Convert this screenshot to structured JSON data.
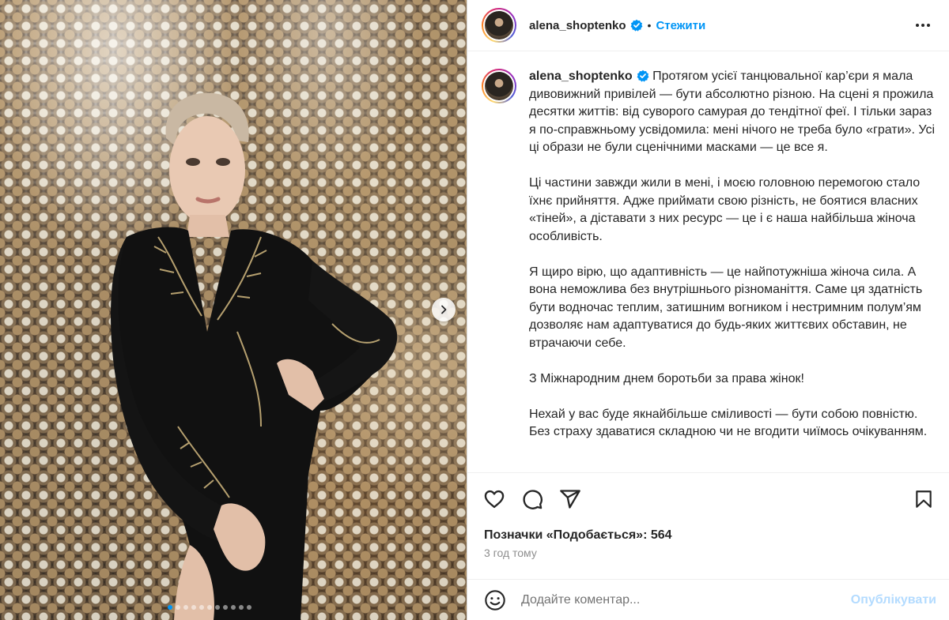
{
  "post": {
    "username": "alena_shoptenko",
    "verified": true,
    "follow_label": "Стежити",
    "separator": "•"
  },
  "caption": {
    "username": "alena_shoptenko",
    "paragraphs": [
      "Протягом усієї танцювальної кар’єри я мала дивовижний привілей — бути абсолютно різною. На сцені я прожила десятки життів: від суворого самурая до тендітної феї. І тільки зараз я по-справжньому усвідомила: мені нічого не треба було «грати». Усі ці образи не були сценічними масками — це все я.",
      "Ці частини завжди жили в мені, і моєю головною перемогою стало їхнє прийняття. Адже приймати свою різність, не боятися власних «тіней», а діставати з них ресурс — це і є наша найбільша жіноча особливість.",
      "Я щиро вірю, що адаптивність — це найпотужніша жіноча сила. А вона неможлива без внутрішнього різноманіття. Саме ця здатність бути водночас теплим, затишним вогником і нестримним полум’ям дозволяє нам адаптуватися до будь-яких життєвих обставин, не втрачаючи себе.",
      "З Міжнародним днем боротьби за права жінок!",
      "Нехай у вас буде якнайбільше сміливості — бути собою повністю. Без страху здаватися складною чи не вгодити чиїмось очікуванням."
    ]
  },
  "engagement": {
    "likes_label": "Позначки «Подобається»: 564",
    "time_ago": "3 год тому"
  },
  "comment": {
    "placeholder": "Додайте коментар...",
    "publish_label": "Опублікувати"
  },
  "carousel": {
    "total": 11,
    "active_index": 0
  },
  "icons": {
    "like": "heart-icon",
    "comment": "comment-icon",
    "share": "share-icon",
    "save": "bookmark-icon",
    "emoji": "emoji-icon",
    "more": "more-options-icon",
    "next": "chevron-right-icon",
    "verified": "verified-badge-icon"
  },
  "colors": {
    "accent": "#0095f6",
    "publish_disabled": "#b3dbff",
    "text": "#262626",
    "muted": "#8e8e8e"
  }
}
